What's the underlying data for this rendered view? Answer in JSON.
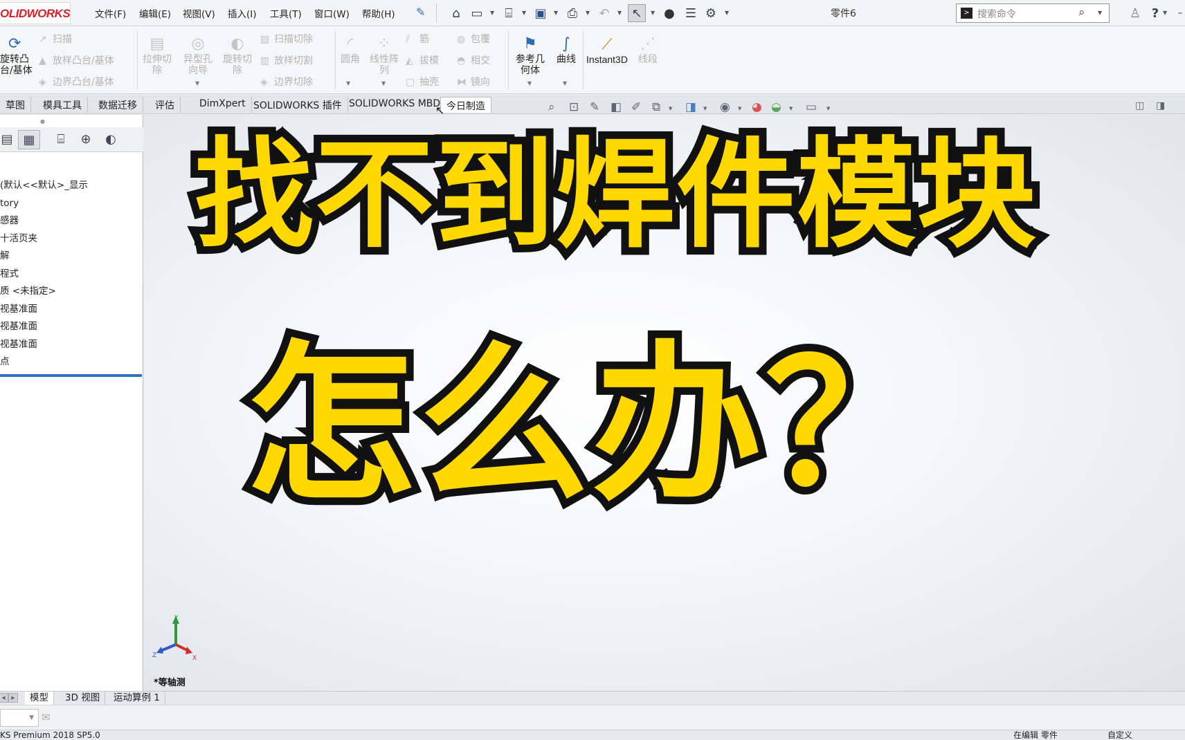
{
  "app": {
    "logo_text": "OLIDWORKS",
    "document_title": "零件6"
  },
  "menu": {
    "items": [
      "文件(F)",
      "编辑(E)",
      "视图(V)",
      "插入(I)",
      "工具(T)",
      "窗口(W)",
      "帮助(H)"
    ]
  },
  "search": {
    "placeholder": "搜索命令",
    "icons": [
      "command-line-icon",
      "search-icon"
    ]
  },
  "ribbon": {
    "revolve_boss": "旋转凸\n台/基体",
    "sweep": "扫描",
    "loft_boss": "放样凸台/基体",
    "boundary_boss": "边界凸台/基体",
    "extruded_cut": "拉伸切\n除",
    "hole_wizard": "异型孔\n向导",
    "revolved_cut": "旋转切\n除",
    "swept_cut": "扫描切除",
    "lofted_cut": "放样切割",
    "boundary_cut": "边界切除",
    "fillet": "圆角",
    "linear_pattern": "线性阵\n列",
    "rib": "筋",
    "draft": "拔模",
    "shell": "抽壳",
    "wrap": "包覆",
    "intersect": "相交",
    "mirror": "镜向",
    "reference_geometry": "参考几\n何体",
    "curves": "曲线",
    "instant3d": "Instant3D",
    "line_segments": "线段"
  },
  "tabs": [
    {
      "label": "草图"
    },
    {
      "label": "模具工具"
    },
    {
      "label": "数据迁移"
    },
    {
      "label": "评估"
    },
    {
      "label": "DimXpert"
    },
    {
      "label": "SOLIDWORKS 插件"
    },
    {
      "label": "SOLIDWORKS MBD"
    },
    {
      "label": "今日制造"
    }
  ],
  "feature_tree": {
    "items": [
      "(默认<<默认>_显示",
      "tory",
      "感器",
      "十活页夹",
      "解",
      "程式",
      "质 <未指定>",
      "视基准面",
      "视基准面",
      "视基准面",
      "点"
    ]
  },
  "viewport": {
    "view_label": "*等轴测",
    "triad": {
      "x": "X",
      "y": "Y",
      "z": "Z"
    }
  },
  "overlay": {
    "line1": "找不到焊件模块",
    "line2": "怎么办？",
    "fill_color": "#ffd800",
    "stroke_color": "#111111"
  },
  "bottom_tabs": [
    {
      "label": "模型"
    },
    {
      "label": "3D 视图"
    },
    {
      "label": "运动算例 1"
    }
  ],
  "status": {
    "product": "KS Premium 2018 SP5.0",
    "editing": "在编辑 零件",
    "units": "自定义"
  },
  "colors": {
    "brand_red": "#d81f26",
    "accent_blue": "#2d72c4"
  }
}
